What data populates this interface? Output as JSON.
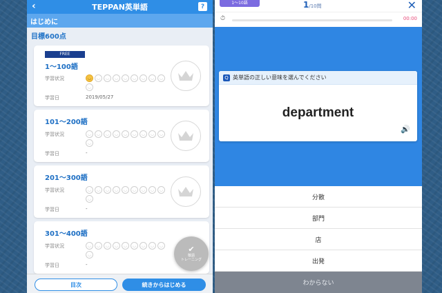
{
  "left": {
    "header": {
      "back": "‹",
      "title": "TEPPAN英単語",
      "help": "?"
    },
    "section_title": "はじめに",
    "goal": "目標600点",
    "status_label": "学習状況",
    "date_label": "学習日",
    "cards": [
      {
        "badge": "FREE",
        "title": "1〜100語",
        "date": "2019/05/27",
        "progress_filled": 1
      },
      {
        "title": "101〜200語",
        "date": "-",
        "progress_filled": 0
      },
      {
        "title": "201〜300語",
        "date": "-",
        "progress_filled": 0
      },
      {
        "title": "301〜400語",
        "date": "-",
        "progress_filled": 0
      }
    ],
    "fab_label": "敬語\nトレーニング",
    "bottom": {
      "toc_label": "目次",
      "continue_label": "続きからはじめる"
    }
  },
  "right": {
    "range_badge": "1〜10語",
    "counter": {
      "current": "1",
      "total": "/10問"
    },
    "close": "✕",
    "timer": "00:00",
    "question_prompt": "英単語の正しい意味を選んでください",
    "word": "department",
    "choices": [
      "分散",
      "部門",
      "店",
      "出発"
    ],
    "dont_know": "わからない"
  },
  "colors": {
    "primary_blue": "#2f8ee6",
    "quiz_blue": "#2f86e3",
    "badge_navy": "#1a3f8f",
    "range_purple": "#7b6be0",
    "timer_pink": "#e84b7a"
  }
}
